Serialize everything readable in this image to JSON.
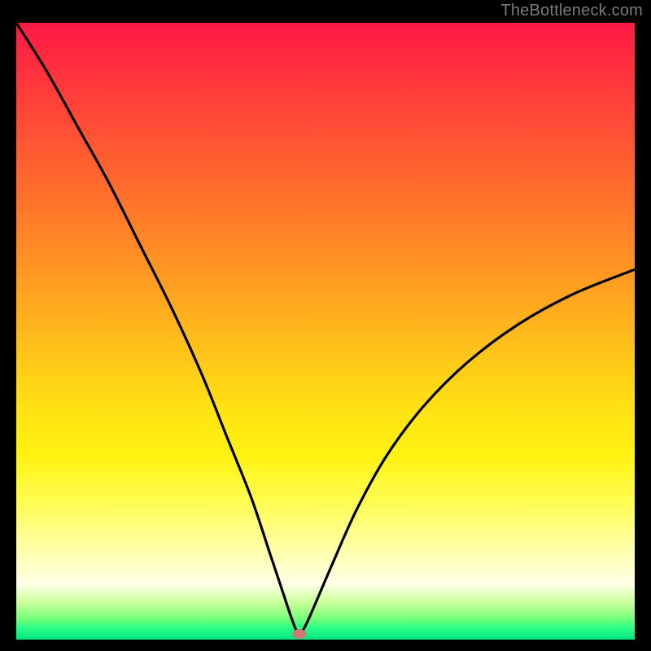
{
  "watermark": "TheBottleneck.com",
  "chart_data": {
    "type": "line",
    "title": "",
    "xlabel": "",
    "ylabel": "",
    "xlim": [
      0,
      100
    ],
    "ylim": [
      0,
      100
    ],
    "series": [
      {
        "name": "bottleneck-curve",
        "x": [
          0,
          5,
          10,
          15,
          20,
          25,
          30,
          34,
          38,
          41,
          43,
          44.5,
          45.5,
          46.5,
          48,
          51,
          55,
          60,
          66,
          73,
          81,
          90,
          100
        ],
        "values": [
          100,
          92,
          83,
          74,
          64,
          54,
          43,
          33,
          23,
          14,
          8,
          3.5,
          1.2,
          1.8,
          5,
          12,
          21,
          30,
          38,
          45,
          51,
          56,
          60
        ]
      }
    ],
    "marker": {
      "x": 45.8,
      "y": 0.9
    },
    "gradient_stops": [
      {
        "pos": 0,
        "color": "#ff1a45"
      },
      {
        "pos": 50,
        "color": "#ffd21a"
      },
      {
        "pos": 85,
        "color": "#ffffb0"
      },
      {
        "pos": 100,
        "color": "#00e482"
      }
    ]
  }
}
